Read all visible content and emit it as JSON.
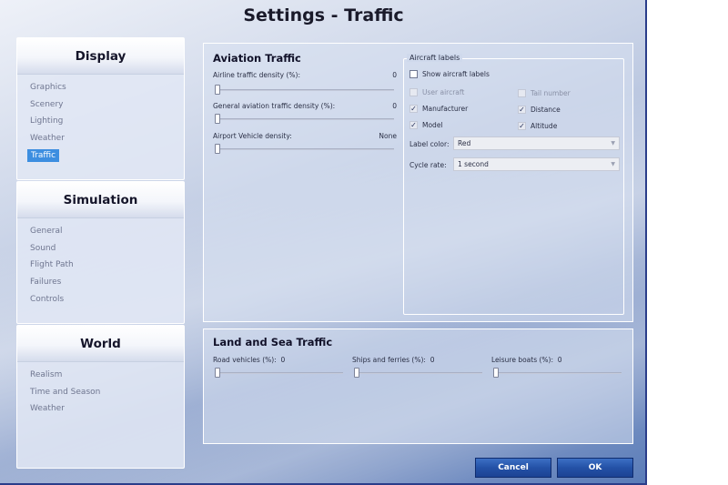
{
  "window": {
    "title": "Settings - Traffic"
  },
  "sidebar": {
    "groups": [
      {
        "header": "Display",
        "items": [
          "Graphics",
          "Scenery",
          "Lighting",
          "Weather",
          "Traffic"
        ],
        "active": "Traffic"
      },
      {
        "header": "Simulation",
        "items": [
          "General",
          "Sound",
          "Flight Path",
          "Failures",
          "Controls"
        ]
      },
      {
        "header": "World",
        "items": [
          "Realism",
          "Time and Season",
          "Weather"
        ]
      }
    ]
  },
  "aviation": {
    "title": "Aviation Traffic",
    "sliders": [
      {
        "label": "Airline traffic density (%):",
        "value": "0",
        "fraction": 0
      },
      {
        "label": "General aviation traffic density (%):",
        "value": "0",
        "fraction": 0
      },
      {
        "label": "Airport Vehicle density:",
        "value": "None",
        "fraction": 0
      }
    ],
    "labels_group": {
      "legend": "Aircraft labels",
      "show_labels": {
        "label": "Show aircraft labels",
        "checked": false
      },
      "options": [
        {
          "label": "User aircraft",
          "checked": false,
          "enabled": false
        },
        {
          "label": "Tail number",
          "checked": false,
          "enabled": false
        },
        {
          "label": "Manufacturer",
          "checked": true,
          "enabled": false
        },
        {
          "label": "Distance",
          "checked": true,
          "enabled": false
        },
        {
          "label": "Model",
          "checked": true,
          "enabled": false
        },
        {
          "label": "Altitude",
          "checked": true,
          "enabled": false
        }
      ],
      "label_color": {
        "label": "Label color:",
        "value": "Red"
      },
      "cycle_rate": {
        "label": "Cycle rate:",
        "value": "1 second"
      }
    }
  },
  "land_sea": {
    "title": "Land and Sea Traffic",
    "sliders": [
      {
        "label": "Road vehicles (%):",
        "value": "0",
        "fraction": 0
      },
      {
        "label": "Ships and ferries (%):",
        "value": "0",
        "fraction": 0
      },
      {
        "label": "Leisure boats (%):",
        "value": "0",
        "fraction": 0
      }
    ]
  },
  "buttons": {
    "cancel": "Cancel",
    "ok": "OK"
  },
  "colors": {
    "accent": "#3d8ee0",
    "button": "#2451a6",
    "border": "#2a3d8a"
  }
}
